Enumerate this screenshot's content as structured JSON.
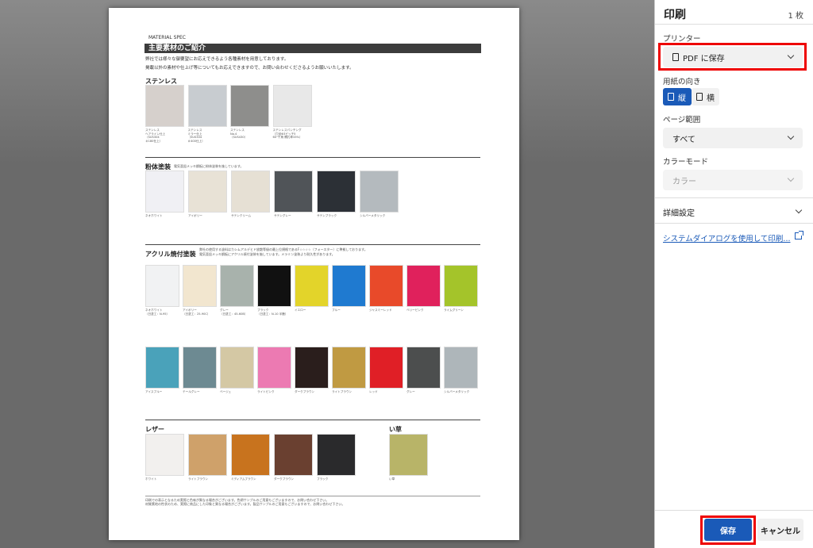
{
  "doc": {
    "label": "MATERIAL SPEC",
    "title": "主要素材のご紹介",
    "intro1": "弊社では様々な御要望にお応えできるよう各種素材を用意しております。",
    "intro2": "掲載以外の素材や仕上げ等についてもお応えできますので、お問い合わせくださるようお願いいたします。",
    "sec_stainless": "ステンレス",
    "stainless": [
      {
        "label": "ステンレス\nヘアライン仕上\n（SUS304\n＃180仕上）",
        "color": "#d6d0cc"
      },
      {
        "label": "ステンレス\nミラー仕上\n（SUS304\n＃400仕上）",
        "color": "#c8ccd0"
      },
      {
        "label": "ステンレス\nNo.4\n（SUS430）",
        "color": "#8e8e8c"
      },
      {
        "label": "ステンレスパンチング\n（穴径Φ3ピッチ5\n60°千鳥 開孔率33%）",
        "color": "#e8e8e8"
      }
    ],
    "sec_powder": "粉体塗装",
    "powder_note": "電気亜鉛メッキ鋼板に粉体塗装を施しています。",
    "powder": [
      {
        "label": "ネオホワイト",
        "color": "#f0f0f4"
      },
      {
        "label": "アイボリー",
        "color": "#e8e2d6"
      },
      {
        "label": "サテンクリーム",
        "color": "#e6e0d4"
      },
      {
        "label": "サテングレー",
        "color": "#505458"
      },
      {
        "label": "サテンブラック",
        "color": "#2c3036"
      },
      {
        "label": "シルバーメタリック",
        "color": "#b4babe"
      }
    ],
    "sec_acrylic": "アクリル焼付塗装",
    "acrylic_note1": "弊社の使用する塗料はカシムアルデヒド放散等級の最上位規格であるF☆☆☆☆（フォースター）に準拠しております。",
    "acrylic_note2": "電気亜鉛メッキ鋼板にアクリル焼付塗装を施しています。メラミン塗装より耐久性があります。",
    "acrylic1": [
      {
        "label": "ネオホワイト\n（日塗工：N-95）",
        "color": "#f1f2f3"
      },
      {
        "label": "アイボリー\n（日塗工：25-90C）",
        "color": "#f2e6cf"
      },
      {
        "label": "グレー\n（日塗工：45-60B）",
        "color": "#a8b2ac"
      },
      {
        "label": "ブラック\n（日塗工：N-10 半艶）",
        "color": "#111111"
      },
      {
        "label": "イエロー",
        "color": "#e3d42a"
      },
      {
        "label": "ブルー",
        "color": "#1f7ad0"
      },
      {
        "label": "ジャスミーレッド",
        "color": "#e84a2a"
      },
      {
        "label": "ベリーピンク",
        "color": "#e0215c"
      },
      {
        "label": "ライムグリーン",
        "color": "#a4c42a"
      }
    ],
    "acrylic2": [
      {
        "label": "アイスブルー",
        "color": "#4aa2ba"
      },
      {
        "label": "テールグレー",
        "color": "#6d8a92"
      },
      {
        "label": "ベージュ",
        "color": "#d4c8a4"
      },
      {
        "label": "ライトピンク",
        "color": "#ec7ab2"
      },
      {
        "label": "ダークブラウン",
        "color": "#2a1e1c"
      },
      {
        "label": "ライトブラウン",
        "color": "#c09a42"
      },
      {
        "label": "レッド",
        "color": "#e01f26"
      },
      {
        "label": "グレー",
        "color": "#4c4e4e"
      },
      {
        "label": "シルバーメタリック",
        "color": "#aeb6ba"
      }
    ],
    "sec_leather": "レザー",
    "leather": [
      {
        "label": "ホワイト",
        "color": "#f2f0ee"
      },
      {
        "label": "ライトブラウン",
        "color": "#cfa16a"
      },
      {
        "label": "ミディアムブラウン",
        "color": "#c8731e"
      },
      {
        "label": "ダークブラウン",
        "color": "#6a4030"
      },
      {
        "label": "ブラック",
        "color": "#2a2a2c"
      }
    ],
    "sec_igusa": "い草",
    "igusa": [
      {
        "label": "い草",
        "color": "#b8b468"
      }
    ],
    "footer1": "印刷での表示となるため実際と色味が異なる場合がございます。色柄サンプルのご用意もございますので、お問い合わせ下さい。",
    "footer2": "材質素地の性状のため、実際に商品にした印象と異なる場合がございます。製品サンプルのご用意もございますので、お問い合わせ下さい。"
  },
  "panel": {
    "title": "印刷",
    "count": "1 枚",
    "printer_label": "プリンター",
    "printer_value": "PDF に保存",
    "orientation_label": "用紙の向き",
    "portrait": "縦",
    "landscape": "横",
    "pages_label": "ページ範囲",
    "pages_value": "すべて",
    "color_label": "カラーモード",
    "color_value": "カラー",
    "advanced": "詳細設定",
    "system_dialog": "システムダイアログを使用して印刷...",
    "save": "保存",
    "cancel": "キャンセル"
  }
}
